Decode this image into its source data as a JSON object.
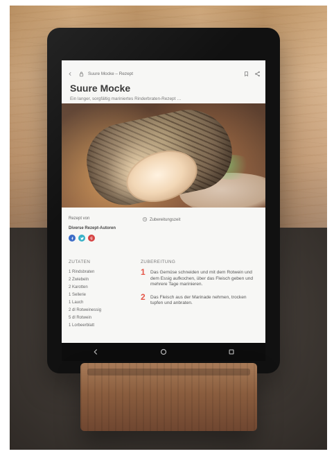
{
  "tablet": {
    "browser": {
      "url_text": "Suure Mocke – Rezept"
    },
    "recipe": {
      "title": "Suure Mocke",
      "subtitle": "Ein langer, sorgfältig mariniertes Rinderbraten-Rezept …",
      "author_label": "Rezept von",
      "author_name": "Diverse Rezept-Autoren",
      "time_label": "Zubereitungszeit",
      "ingredients_header": "ZUTATEN",
      "ingredients": [
        "1 Rindsbraten",
        "2 Zwiebeln",
        "2 Karotten",
        "1 Sellerie",
        "1 Lauch",
        "2 dl Rotweinessig",
        "5 dl Rotwein",
        "1 Lorbeerblatt"
      ],
      "steps_header": "ZUBEREITUNG",
      "steps": [
        {
          "num": "1",
          "text": "Das Gemüse schneiden und mit dem Rotwein und dem Essig aufkochen, über das Fleisch geben und mehrere Tage marinieren."
        },
        {
          "num": "2",
          "text": "Das Fleisch aus der Marinade nehmen, trocken tupfen und anbraten."
        }
      ]
    }
  },
  "colors": {
    "accent_red": "#e55649",
    "social_blue": "#3d6cc7",
    "social_teal": "#38b1c7",
    "social_red": "#d64343"
  }
}
